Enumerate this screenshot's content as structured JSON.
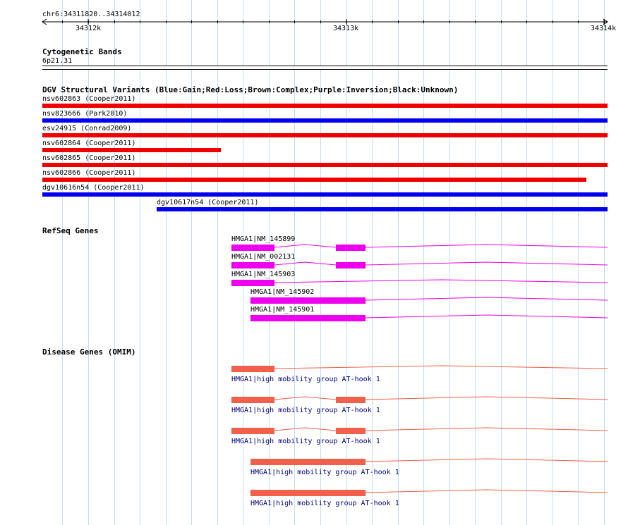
{
  "ruler": {
    "location": "chr6:34311820..34314012",
    "ticks": [
      "34312k",
      "34313k",
      "34314k"
    ]
  },
  "tracks": {
    "cytoband": {
      "title": "Cytogenetic Bands",
      "band": "6p21.31"
    },
    "dgv": {
      "title": "DGV Structural Variants (Blue:Gain;Red:Loss;Brown:Complex;Purple:Inversion;Black:Unknown)",
      "colors": {
        "gain": "#0000ee",
        "loss": "#ee0000"
      },
      "items": [
        {
          "label": "nsv602863 (Cooper2011)",
          "type": "loss"
        },
        {
          "label": "nsv823666 (Park2010)",
          "type": "gain"
        },
        {
          "label": "esv24915 (Conrad2009)",
          "type": "loss"
        },
        {
          "label": "nsv602864 (Cooper2011)",
          "type": "loss"
        },
        {
          "label": "nsv602865 (Cooper2011)",
          "type": "loss"
        },
        {
          "label": "nsv602866 (Cooper2011)",
          "type": "loss"
        },
        {
          "label": "dgv10616n54 (Cooper2011)",
          "type": "gain"
        },
        {
          "label": "dgv10617n54 (Cooper2011)",
          "type": "gain"
        }
      ]
    },
    "refseq": {
      "title": "RefSeq Genes",
      "color": "#ee00ee",
      "items": [
        {
          "label": "HMGA1|NM_145899"
        },
        {
          "label": "HMGA1|NM_002131"
        },
        {
          "label": "HMGA1|NM_145903"
        },
        {
          "label": "HMGA1|NM_145902"
        },
        {
          "label": "HMGA1|NM_145901"
        }
      ]
    },
    "omim": {
      "title": "Disease Genes (OMIM)",
      "color": "#f0604a",
      "label_color": "#000080",
      "items": [
        {
          "label": "HMGA1|high mobility group AT-hook 1"
        },
        {
          "label": "HMGA1|high mobility group AT-hook 1"
        },
        {
          "label": "HMGA1|high mobility group AT-hook 1"
        },
        {
          "label": "HMGA1|high mobility group AT-hook 1"
        },
        {
          "label": "HMGA1|high mobility group AT-hook 1"
        }
      ]
    }
  }
}
